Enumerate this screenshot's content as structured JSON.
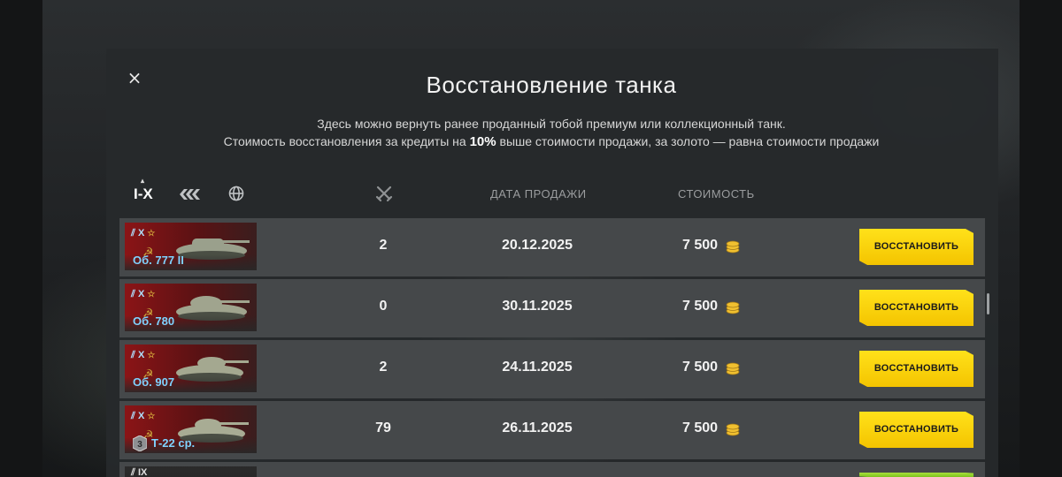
{
  "dialog": {
    "title": "Восстановление танка",
    "close_label": "×",
    "description_line1": "Здесь можно вернуть ранее проданный тобой премиум или коллекционный танк.",
    "description_line2_pre": "Стоимость восстановления за кредиты на ",
    "description_line2_bold": "10%",
    "description_line2_post": " выше стоимости продажи, за золото — равна стоимости продажи"
  },
  "filters": {
    "tier_label": "I-X",
    "caret": "▴",
    "type_icon": "vehicle-type-icon",
    "nation_icon": "globe-icon"
  },
  "columns": {
    "battles_icon": "crossed-swords-icon",
    "date": "ДАТА ПРОДАЖИ",
    "cost": "СТОИМОСТЬ"
  },
  "colors": {
    "accent_yellow": "#f4c400",
    "accent_green": "#7cc21e",
    "tank_name": "#7fd3ff",
    "soviet_red": "#8b1416"
  },
  "rows": [
    {
      "tier": "X",
      "name": "Об. 777 II",
      "battles": "2",
      "date": "20.12.2025",
      "cost": "7 500",
      "button": "ВОССТАНОВИТЬ",
      "mastery": ""
    },
    {
      "tier": "X",
      "name": "Об. 780",
      "battles": "0",
      "date": "30.11.2025",
      "cost": "7 500",
      "button": "ВОССТАНОВИТЬ",
      "mastery": ""
    },
    {
      "tier": "X",
      "name": "Об. 907",
      "battles": "2",
      "date": "24.11.2025",
      "cost": "7 500",
      "button": "ВОССТАНОВИТЬ",
      "mastery": ""
    },
    {
      "tier": "X",
      "name": "Т-22 ср.",
      "battles": "79",
      "date": "26.11.2025",
      "cost": "7 500",
      "button": "ВОССТАНОВИТЬ",
      "mastery": "3"
    },
    {
      "tier": "IX",
      "name": "",
      "battles": "",
      "date": "",
      "cost": "",
      "button": "",
      "mastery": ""
    }
  ]
}
